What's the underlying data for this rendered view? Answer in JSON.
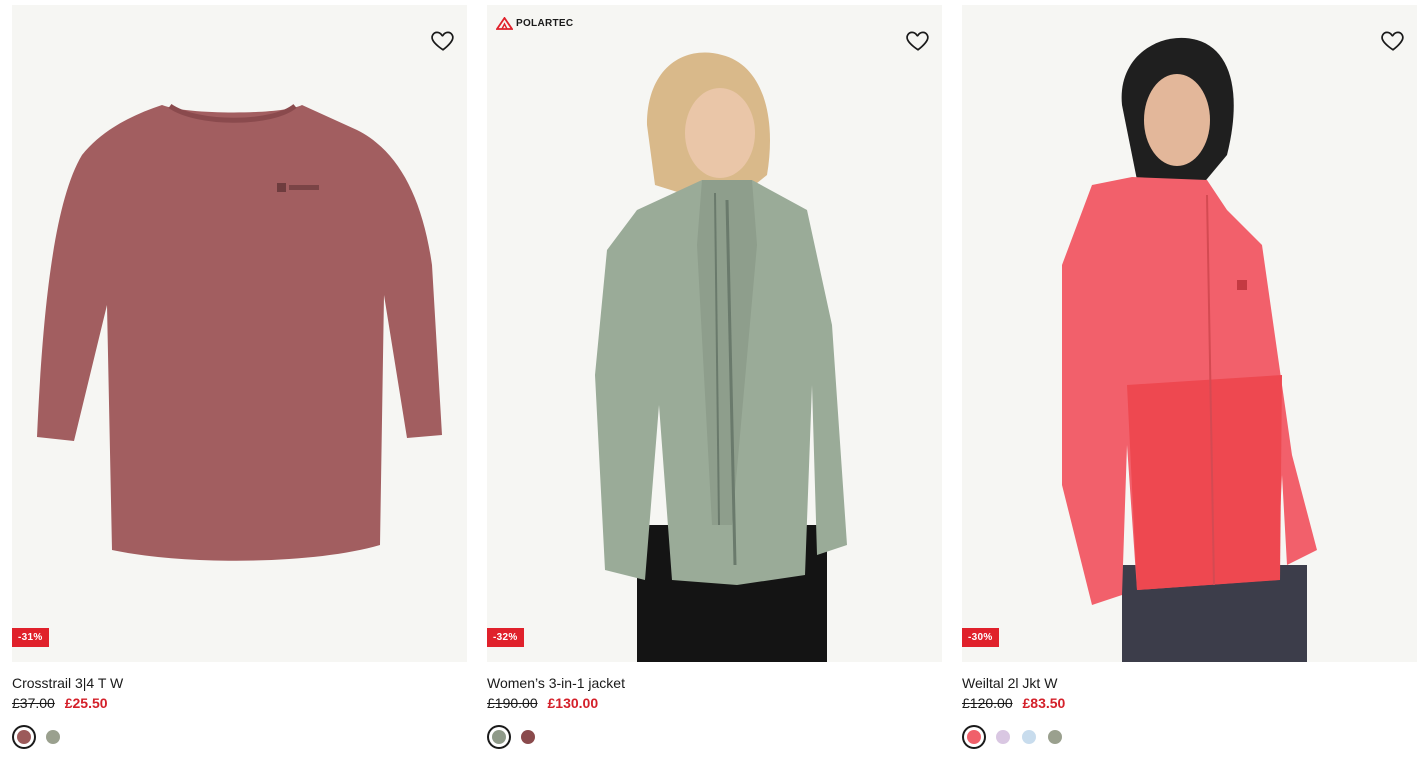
{
  "products": [
    {
      "name": "Crosstrail 3|4 T W",
      "old_price": "£37.00",
      "new_price": "£25.50",
      "discount": "-31%",
      "brand_badge": "",
      "swatches": [
        "#9c5a5a",
        "#9aa08e"
      ],
      "selected_swatch": 0,
      "image": "rose long-sleeve t-shirt"
    },
    {
      "name": "Women’s 3-in-1 jacket",
      "old_price": "£190.00",
      "new_price": "£130.00",
      "discount": "-32%",
      "brand_badge": "POLARTEC",
      "swatches": [
        "#8f9a89",
        "#8a4a4c"
      ],
      "selected_swatch": 0,
      "image": "woman wearing sage green 3-in-1 jacket"
    },
    {
      "name": "Weiltal 2l Jkt W",
      "old_price": "£120.00",
      "new_price": "£83.50",
      "discount": "-30%",
      "brand_badge": "",
      "swatches": [
        "#f0606a",
        "#d9c7e2",
        "#c8dced",
        "#9aa08e"
      ],
      "selected_swatch": 0,
      "image": "woman wearing coral hardshell jacket"
    }
  ],
  "icons": {
    "wishlist": "heart-outline-icon",
    "brand": "polartec-logo-icon"
  },
  "colors": {
    "sale_red": "#d4202a",
    "badge_red": "#e0212b",
    "card_bg": "#f6f6f3"
  }
}
